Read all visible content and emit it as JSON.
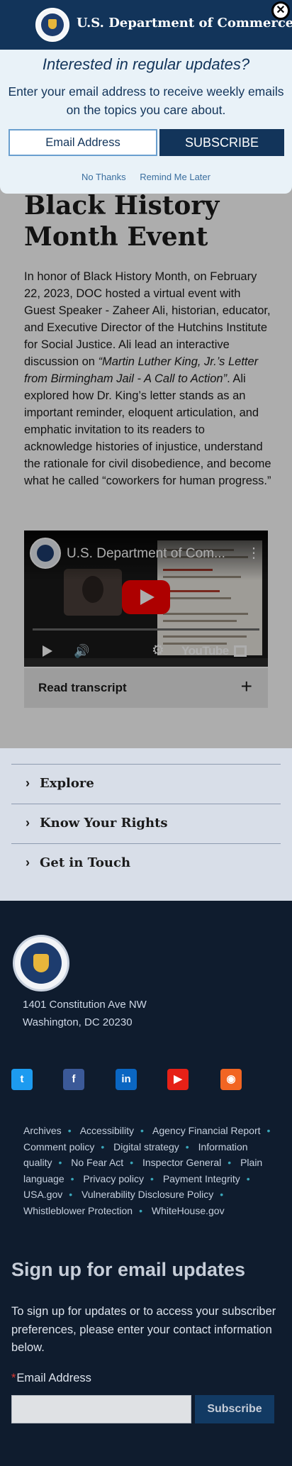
{
  "modal": {
    "agency": "U.S. Department of Commerce",
    "close_symbol": "✕",
    "heading": "Interested in regular updates?",
    "text": "Enter your email address to receive weekly emails on the topics you care about.",
    "email_placeholder": "Email Address",
    "subscribe_label": "SUBSCRIBE",
    "no_thanks": "No Thanks",
    "remind_later": "Remind Me Later"
  },
  "article": {
    "title": "Black History Month Event",
    "body_part1": "In honor of Black History Month, on February 22, 2023, DOC hosted a virtual event with Guest Speaker - Zaheer Ali, historian, educator, and Executive Director of the Hutchins Institute for Social Justice. Ali lead an interactive discussion on ",
    "body_italic": "“Martin Luther King, Jr.’s Letter from Birmingham Jail - A Call to Action”",
    "body_part2": ". Ali explored how Dr. King’s letter stands as an important reminder, eloquent articulation, and emphatic invitation to its readers to acknowledge histories of injustice, understand the rationale for civil disobedience, and become what he called “coworkers for human progress.”",
    "video_title": "U.S. Department of Com...",
    "video_brand": "YouTube",
    "transcript_label": "Read transcript",
    "transcript_toggle": "+"
  },
  "accordion": {
    "items": [
      {
        "label": "Explore"
      },
      {
        "label": "Know Your Rights"
      },
      {
        "label": "Get in Touch"
      }
    ]
  },
  "footer": {
    "address_line1": "1401 Constitution Ave NW",
    "address_line2": "Washington, DC 20230",
    "social": [
      {
        "name": "twitter",
        "glyph": "t",
        "color": "#1d9bf0"
      },
      {
        "name": "facebook",
        "glyph": "f",
        "color": "#3b5998"
      },
      {
        "name": "linkedin",
        "glyph": "in",
        "color": "#0a66c2"
      },
      {
        "name": "youtube",
        "glyph": "▶",
        "color": "#e62117"
      },
      {
        "name": "rss",
        "glyph": "◉",
        "color": "#f26522"
      }
    ],
    "links": [
      "Archives",
      "Accessibility",
      "Agency Financial Report",
      "Comment policy",
      "Digital strategy",
      "Information quality",
      "No Fear Act",
      "Inspector General",
      "Plain language",
      "Privacy policy",
      "Payment Integrity",
      "USA.gov",
      "Vulnerability Disclosure Policy",
      "Whistleblower Protection",
      "WhiteHouse.gov"
    ],
    "signup_title": "Sign up for email updates",
    "signup_text": "To sign up for updates or to access your subscriber preferences, please enter your contact information below.",
    "email_label": "Email Address",
    "required_marker": "*",
    "subscribe_label": "Subscribe"
  }
}
